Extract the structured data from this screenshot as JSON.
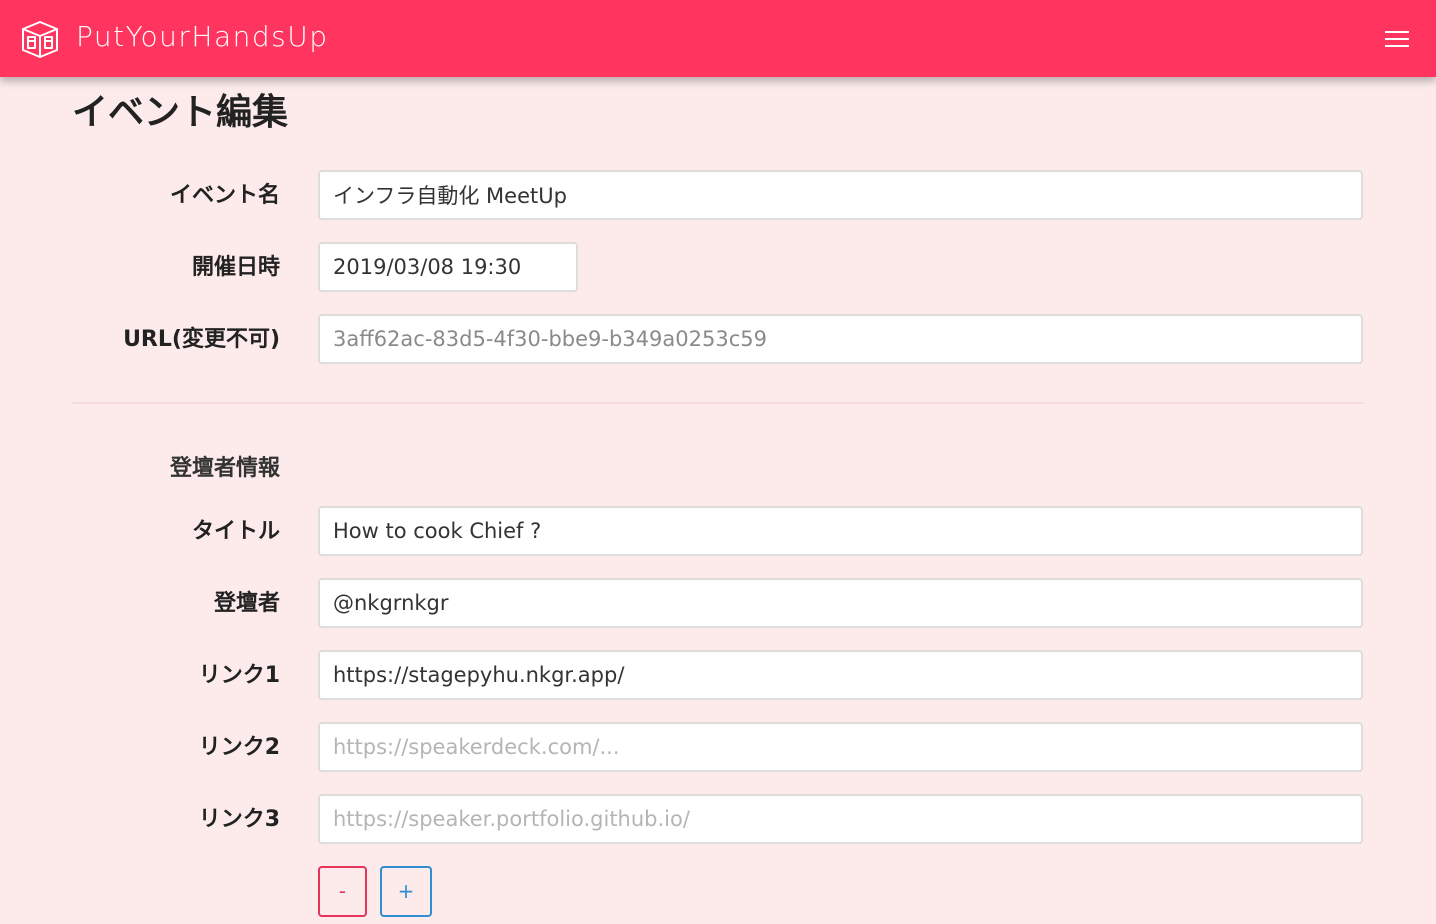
{
  "navbar": {
    "brand": "PutYourHandsUp",
    "logo_icon": "hands-up-logo-icon",
    "menu_icon": "hamburger-menu-icon",
    "background": "#ff345f"
  },
  "page": {
    "title": "イベント編集"
  },
  "event": {
    "name_label": "イベント名",
    "name_value": "インフラ自動化 MeetUp",
    "datetime_label": "開催日時",
    "datetime_value": "2019/03/08 19:30",
    "url_label": "URL(変更不可)",
    "url_value": "3aff62ac-83d5-4f30-bbe9-b349a0253c59"
  },
  "speaker": {
    "section_label": "登壇者情報",
    "title_label": "タイトル",
    "title_value": "How to cook Chief ?",
    "speaker_label": "登壇者",
    "speaker_value": "@nkgrnkgr",
    "link1_label": "リンク1",
    "link1_value": "https://stagepyhu.nkgr.app/",
    "link2_label": "リンク2",
    "link2_placeholder": "https://speakerdeck.com/...",
    "link3_label": "リンク3",
    "link3_placeholder": "https://speaker.portfolio.github.io/",
    "remove_label": "-",
    "add_label": "+"
  },
  "colors": {
    "accent": "#ff345f",
    "page_background": "#fcebea",
    "remove_button": "#e5335a",
    "add_button": "#2f8ed0"
  }
}
